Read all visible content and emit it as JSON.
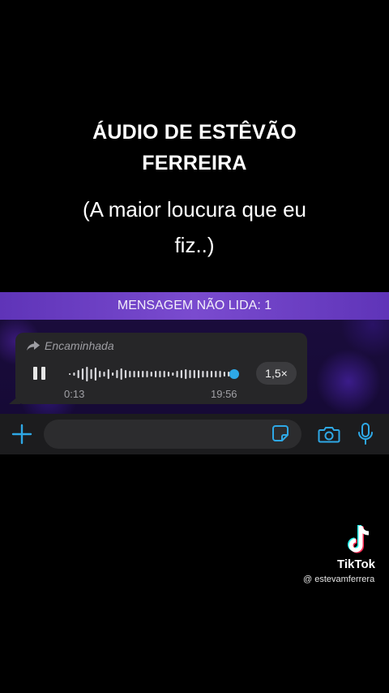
{
  "overlay": {
    "title_line1": "ÁUDIO DE ESTÊVÃO",
    "title_line2": "FERREIRA",
    "subtitle_line1": "(A maior loucura que eu",
    "subtitle_line2": "fiz..)"
  },
  "chat": {
    "unread_banner": "MENSAGEM NÃO LIDA: 1",
    "message": {
      "forwarded_label": "Encaminhada",
      "elapsed": "0:13",
      "duration": "19:56",
      "speed": "1,5×",
      "playback_progress": 0.01
    },
    "input": {
      "value": ""
    }
  },
  "watermark": {
    "brand": "TikTok",
    "username": "@ estevamferrera"
  },
  "colors": {
    "accent": "#2ea8e6",
    "banner": "#6b3fc4",
    "bubble": "#262628"
  },
  "icons": [
    "share-arrow-icon",
    "pause-icon",
    "plus-icon",
    "sticker-icon",
    "camera-icon",
    "microphone-icon",
    "tiktok-logo-icon"
  ]
}
